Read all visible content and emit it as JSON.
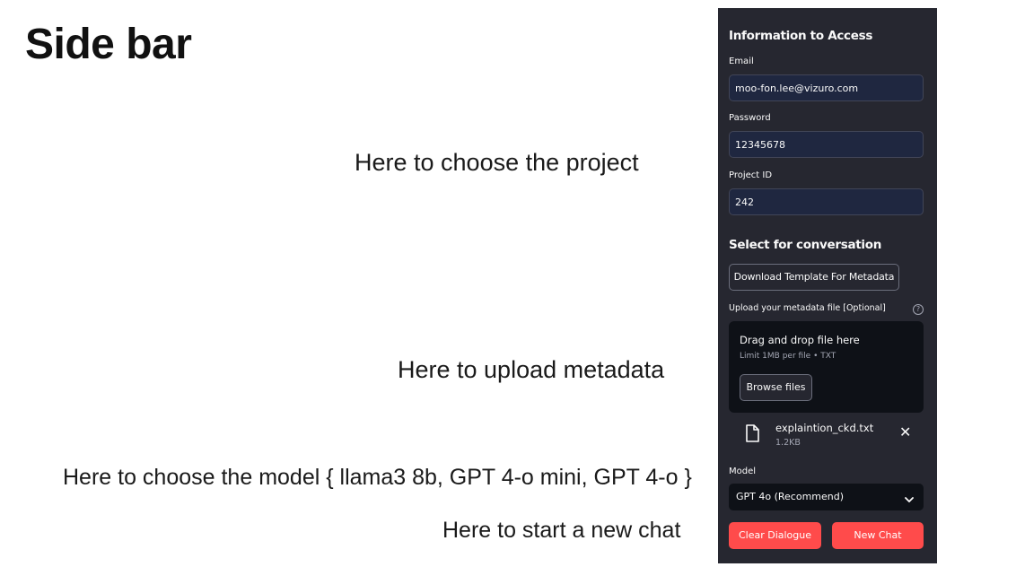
{
  "slide": {
    "title": "Side bar",
    "notes": {
      "project": "Here to choose the project",
      "upload": "Here to upload metadata",
      "model": "Here to choose the model { llama3 8b, GPT 4-o mini, GPT 4-o }",
      "new_chat": "Here to start a new chat"
    }
  },
  "sidebar": {
    "access_title": "Information to Access",
    "email": {
      "label": "Email",
      "value": "moo-fon.lee@vizuro.com"
    },
    "password": {
      "label": "Password",
      "value": "12345678"
    },
    "project_id": {
      "label": "Project ID",
      "value": "242"
    },
    "conversation_title": "Select for conversation",
    "download_template_label": "Download Template For Metadata",
    "upload": {
      "label": "Upload your metadata file [Optional]",
      "help_icon": "question-circle-icon",
      "drop_title": "Drag and drop file here",
      "drop_limit": "Limit 1MB per file • TXT",
      "browse_label": "Browse files",
      "file": {
        "icon": "file-icon",
        "name": "explaintion_ckd.txt",
        "size": "1.2KB",
        "remove_icon": "close-icon"
      }
    },
    "model": {
      "label": "Model",
      "selected": "GPT 4o (Recommend)",
      "chevron_icon": "chevron-down-icon"
    },
    "clear_label": "Clear Dialogue",
    "new_chat_label": "New Chat"
  },
  "colors": {
    "sidebar_bg": "#262730",
    "input_bg": "#1f2740",
    "dropzone_bg": "#0e1117",
    "primary": "#ff4b4b",
    "text_light": "#fafafa"
  }
}
